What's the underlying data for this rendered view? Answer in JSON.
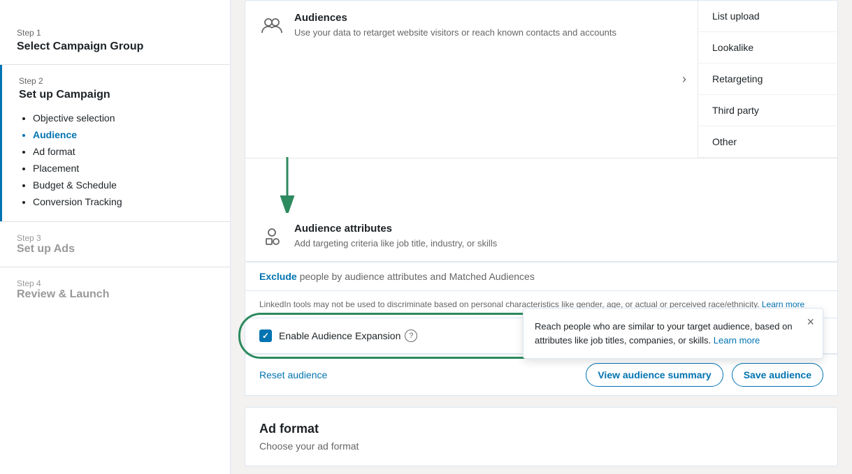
{
  "sidebar": {
    "step1": {
      "label": "Step 1",
      "title": "Select Campaign Group"
    },
    "step2": {
      "label": "Step 2",
      "title": "Set up Campaign",
      "nav_items": [
        {
          "id": "objective",
          "label": "Objective selection",
          "active": false
        },
        {
          "id": "audience",
          "label": "Audience",
          "active": true
        },
        {
          "id": "ad_format",
          "label": "Ad format",
          "active": false
        },
        {
          "id": "placement",
          "label": "Placement",
          "active": false
        },
        {
          "id": "budget",
          "label": "Budget & Schedule",
          "active": false
        },
        {
          "id": "conversion",
          "label": "Conversion Tracking",
          "active": false
        }
      ]
    },
    "step3": {
      "label": "Step 3",
      "title": "Set up Ads"
    },
    "step4": {
      "label": "Step 4",
      "title": "Review & Launch"
    }
  },
  "audiences_panel": {
    "audiences": {
      "title": "Audiences",
      "description": "Use your data to retarget website visitors or reach known contacts and accounts"
    },
    "audience_attributes": {
      "title": "Audience attributes",
      "description": "Add targeting criteria like job title, industry, or skills"
    },
    "submenu_items": [
      "List upload",
      "Lookalike",
      "Retargeting",
      "Third party",
      "Other"
    ]
  },
  "exclude_row": {
    "link_text": "Exclude",
    "text": " people by audience attributes and Matched Audiences"
  },
  "disclaimer": {
    "text": "LinkedIn tools may not be used to discriminate based on personal characteristics like gender, age, or actual or perceived race/ethnicity.",
    "learn_more": "Learn more"
  },
  "expansion": {
    "label": "Enable Audience Expansion",
    "tooltip": {
      "text": "Reach people who are similar to your target audience, based on attributes like job titles, companies, or skills.",
      "learn_more": "Learn more"
    }
  },
  "actions": {
    "reset": "Reset audience",
    "view_summary": "View audience summary",
    "save": "Save audience"
  },
  "ad_format": {
    "title": "Ad format",
    "subtitle": "Choose your ad format"
  }
}
